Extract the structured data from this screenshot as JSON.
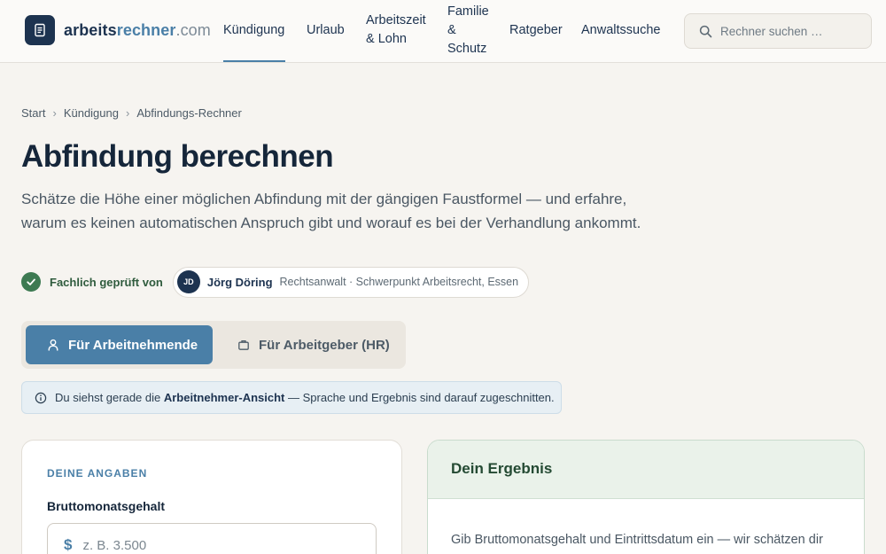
{
  "header": {
    "logo": {
      "part1": "arbeits",
      "part2": "rechner",
      "part3": ".com"
    },
    "nav": [
      {
        "label": "Kündigung"
      },
      {
        "label": "Urlaub"
      },
      {
        "label": "Arbeitszeit\n& Lohn"
      },
      {
        "label": "Familie\n&\nSchutz"
      },
      {
        "label": "Ratgeber"
      },
      {
        "label": "Anwaltssuche"
      }
    ],
    "active_nav": "Kündigung",
    "search": {
      "placeholder": "Rechner suchen …"
    }
  },
  "breadcrumb": [
    "Start",
    "Kündigung",
    "Abfindungs-Rechner"
  ],
  "page": {
    "title": "Abfindung berechnen",
    "lead": "Schätze die Höhe einer möglichen Abfindung mit der gängigen Faustformel — und erfahre, warum es keinen automatischen Anspruch gibt und worauf es bei der Verhandlung ankommt."
  },
  "reviewer": {
    "checked_label": "Fachlich geprüft von",
    "initials": "JD",
    "name": "Jörg Döring",
    "role": "Rechtsanwalt · Schwerpunkt Arbeitsrecht, Essen"
  },
  "toggle": {
    "employee": "Für Arbeitnehmende",
    "employer": "Für Arbeitgeber (HR)",
    "active": "employee"
  },
  "info": {
    "prefix": "Du siehst gerade die ",
    "highlight": "Arbeitnehmer-Ansicht",
    "suffix": " — Sprache und Ergebnis sind darauf zugeschnitten."
  },
  "form": {
    "section_label": "DEINE ANGABEN",
    "salary_label": "Bruttomonatsgehalt",
    "currency_symbol": "$",
    "salary_placeholder": "z. B. 3.500",
    "salary_value": ""
  },
  "result": {
    "title": "Dein Ergebnis",
    "body": "Gib Bruttomonatsgehalt und Eintrittsdatum ein — wir schätzen dir mögliche Abfindung."
  },
  "colors": {
    "brand_dark": "#1d3350",
    "accent": "#4a7fa7",
    "success": "#3d7a52",
    "background": "#f6f4f0"
  }
}
